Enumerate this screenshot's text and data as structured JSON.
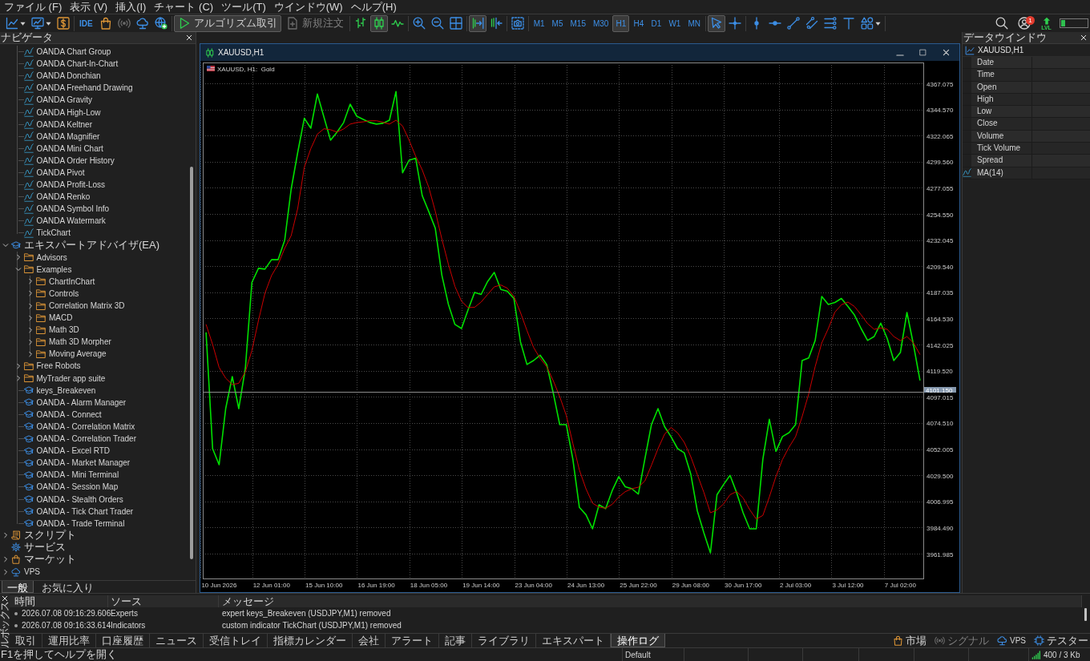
{
  "menu": [
    "ファイル (F)",
    "表示 (V)",
    "挿入(I)",
    "チャート (C)",
    "ツール(T)",
    "ウインドウ(W)",
    "ヘルプ(H)"
  ],
  "toolbar": {
    "groups": [
      {
        "items": [
          {
            "kind": "new_chart"
          },
          {
            "kind": "profiles"
          },
          {
            "kind": "dollar"
          }
        ]
      },
      {
        "items": [
          {
            "kind": "ide",
            "label": "IDE",
            "disabled": false
          },
          {
            "kind": "market",
            "disabled": false
          },
          {
            "kind": "signals",
            "disabled": true
          },
          {
            "kind": "vps",
            "disabled": false
          },
          {
            "kind": "webtrader",
            "disabled": false
          }
        ]
      },
      {
        "items": [
          {
            "kind": "algo",
            "label": "アルゴリズム取引",
            "selected": true,
            "disabled": false
          },
          {
            "kind": "new_order",
            "label": "新規注文",
            "selected": false,
            "disabled": true
          }
        ]
      },
      {
        "items": [
          {
            "kind": "bars",
            "selected": false
          },
          {
            "kind": "candles",
            "selected": true
          },
          {
            "kind": "line",
            "selected": false
          }
        ]
      },
      {
        "items": [
          {
            "kind": "zoom_in"
          },
          {
            "kind": "zoom_out"
          },
          {
            "kind": "tile"
          }
        ]
      },
      {
        "items": [
          {
            "kind": "autoscroll",
            "selected": true
          },
          {
            "kind": "shift",
            "selected": false
          }
        ]
      },
      {
        "items": [
          {
            "kind": "screenshot"
          }
        ]
      },
      {
        "items": [
          {
            "kind": "tf",
            "label": "M1",
            "selected": false
          },
          {
            "kind": "tf",
            "label": "M5",
            "selected": false
          },
          {
            "kind": "tf",
            "label": "M15",
            "selected": false
          },
          {
            "kind": "tf",
            "label": "M30",
            "selected": false
          },
          {
            "kind": "tf",
            "label": "H1",
            "selected": true
          },
          {
            "kind": "tf",
            "label": "H4",
            "selected": false
          },
          {
            "kind": "tf",
            "label": "D1",
            "selected": false
          },
          {
            "kind": "tf",
            "label": "W1",
            "selected": false
          },
          {
            "kind": "tf",
            "label": "MN",
            "selected": false
          }
        ]
      },
      {
        "items": [
          {
            "kind": "cursor",
            "selected": true
          },
          {
            "kind": "crosshair",
            "selected": false
          }
        ]
      },
      {
        "items": [
          {
            "kind": "vline"
          },
          {
            "kind": "hline"
          },
          {
            "kind": "trendline"
          },
          {
            "kind": "channel"
          },
          {
            "kind": "fibo"
          },
          {
            "kind": "text"
          },
          {
            "kind": "shapes"
          }
        ]
      }
    ],
    "right": [
      {
        "kind": "search"
      },
      {
        "kind": "account",
        "badge": "1"
      },
      {
        "kind": "level",
        "label": "LVL"
      }
    ],
    "meter": {
      "level": 0.15
    }
  },
  "navigator": {
    "title": "ナビゲータ",
    "tree": [
      {
        "children": [
          {
            "kind": "indicator",
            "label": "OANDA Chart Group"
          },
          {
            "kind": "indicator",
            "label": "OANDA Chart-In-Chart"
          },
          {
            "kind": "indicator",
            "label": "OANDA Donchian"
          },
          {
            "kind": "indicator",
            "label": "OANDA Freehand Drawing"
          },
          {
            "kind": "indicator",
            "label": "OANDA Gravity"
          },
          {
            "kind": "indicator",
            "label": "OANDA High-Low"
          },
          {
            "kind": "indicator",
            "label": "OANDA Keltner"
          },
          {
            "kind": "indicator",
            "label": "OANDA Magnifier"
          },
          {
            "kind": "indicator",
            "label": "OANDA Mini Chart"
          },
          {
            "kind": "indicator",
            "label": "OANDA Order History"
          },
          {
            "kind": "indicator",
            "label": "OANDA Pivot"
          },
          {
            "kind": "indicator",
            "label": "OANDA Profit-Loss"
          },
          {
            "kind": "indicator",
            "label": "OANDA Renko"
          },
          {
            "kind": "indicator",
            "label": "OANDA Symbol Info"
          },
          {
            "kind": "indicator",
            "label": "OANDA Watermark"
          },
          {
            "kind": "indicator",
            "label": "TickChart"
          }
        ]
      },
      {
        "kind": "expert",
        "label": "エキスパートアドバイザ(EA)",
        "expanded": true,
        "children": [
          {
            "kind": "folder",
            "label": "Advisors",
            "expanded": false
          },
          {
            "kind": "folder",
            "label": "Examples",
            "expanded": true,
            "children": [
              {
                "kind": "folder",
                "label": "ChartInChart",
                "expanded": false
              },
              {
                "kind": "folder",
                "label": "Controls",
                "expanded": false
              },
              {
                "kind": "folder",
                "label": "Correlation Matrix 3D",
                "expanded": false
              },
              {
                "kind": "folder",
                "label": "MACD",
                "expanded": false
              },
              {
                "kind": "folder",
                "label": "Math 3D",
                "expanded": false
              },
              {
                "kind": "folder",
                "label": "Math 3D Morpher",
                "expanded": false
              },
              {
                "kind": "folder",
                "label": "Moving Average",
                "expanded": false
              }
            ]
          },
          {
            "kind": "folder",
            "label": "Free Robots",
            "expanded": false
          },
          {
            "kind": "folder",
            "label": "MyTrader app suite",
            "expanded": false
          },
          {
            "kind": "expert",
            "label": "keys_Breakeven"
          },
          {
            "kind": "expert",
            "label": "OANDA - Alarm Manager"
          },
          {
            "kind": "expert",
            "label": "OANDA - Connect"
          },
          {
            "kind": "expert",
            "label": "OANDA - Correlation Matrix"
          },
          {
            "kind": "expert",
            "label": "OANDA - Correlation Trader"
          },
          {
            "kind": "expert",
            "label": "OANDA - Excel RTD"
          },
          {
            "kind": "expert",
            "label": "OANDA - Market Manager"
          },
          {
            "kind": "expert",
            "label": "OANDA - Mini Terminal"
          },
          {
            "kind": "expert",
            "label": "OANDA - Session Map"
          },
          {
            "kind": "expert",
            "label": "OANDA - Stealth Orders"
          },
          {
            "kind": "expert",
            "label": "OANDA - Tick Chart Trader"
          },
          {
            "kind": "expert",
            "label": "OANDA - Trade Terminal"
          }
        ]
      },
      {
        "kind": "script",
        "label": "スクリプト",
        "expanded": false
      },
      {
        "kind": "service",
        "label": "サービス"
      },
      {
        "kind": "market",
        "label": "マーケット",
        "expanded": false
      },
      {
        "kind": "vps",
        "label": "VPS",
        "expanded": false
      }
    ],
    "tabs": [
      {
        "label": "一般",
        "selected": true
      },
      {
        "label": "お気に入り",
        "selected": false
      }
    ]
  },
  "chart_window": {
    "title": "XAUUSD,H1",
    "info": "XAUUSD, H1:  Gold",
    "chart_data": {
      "type": "line",
      "grid": true,
      "categories": [
        null,
        null,
        "10 Jun 2026",
        null,
        null,
        null,
        null,
        null,
        null,
        null,
        "12 Jun 01:00",
        null,
        null,
        null,
        null,
        null,
        null,
        null,
        "15 Jun 10:00",
        null,
        null,
        null,
        null,
        null,
        null,
        null,
        "16 Jun 19:00",
        null,
        null,
        null,
        null,
        null,
        null,
        null,
        "18 Jun 05:00",
        null,
        null,
        null,
        null,
        null,
        null,
        null,
        "19 Jun 14:00",
        null,
        null,
        null,
        null,
        null,
        null,
        null,
        "23 Jun 04:00",
        null,
        null,
        null,
        null,
        null,
        null,
        null,
        "24 Jun 13:00",
        null,
        null,
        null,
        null,
        null,
        null,
        null,
        "25 Jun 22:00",
        null,
        null,
        null,
        null,
        null,
        null,
        null,
        "29 Jun 08:00",
        null,
        null,
        null,
        null,
        null,
        null,
        null,
        "30 Jun 17:00",
        null,
        null,
        null,
        null,
        null,
        null,
        null,
        "2 Jul 03:00",
        null,
        null,
        null,
        null,
        null,
        null,
        null,
        "3 Jul 12:00",
        null,
        null,
        null,
        null,
        null,
        null,
        null,
        "7 Jul 02:00",
        null,
        null,
        null
      ],
      "series": [
        {
          "color": "#00e000",
          "values": [
            4152.5,
            4052.4,
            4038.6,
            4086.9,
            4114.5,
            4086.9,
            4121.4,
            4195.6,
            4207.7,
            4207.0,
            4215.2,
            4215.2,
            4231.8,
            4276.0,
            4307.7,
            4337.0,
            4328.4,
            4357.8,
            4337.9,
            4318.1,
            4325.0,
            4333.2,
            4349.1,
            4338.8,
            4336.0,
            4333.3,
            4331.9,
            4332.6,
            4335.3,
            4360.0,
            4290.0,
            4300.8,
            4302.6,
            4270.4,
            4256.6,
            4242.2,
            4201.9,
            4176.6,
            4159.4,
            4155.9,
            4172.0,
            4187.0,
            4185.2,
            4196.5,
            4204.2,
            4189.6,
            4187.9,
            4181.8,
            4144.4,
            4124.9,
            4128.3,
            4132.9,
            4124.9,
            4100.7,
            4073.1,
            4073.1,
            4043.2,
            4001.8,
            3995.5,
            3983.4,
            4004.1,
            4000.7,
            4016.2,
            4028.3,
            4019.6,
            4017.9,
            4013.3,
            4043.8,
            4073.1,
            4086.9,
            4071.4,
            4062.7,
            4052.4,
            4048.9,
            4030.5,
            3998.9,
            3980.0,
            3962.7,
            4012.7,
            4021.4,
            4029.4,
            4014.5,
            3997.2,
            3983.4,
            3983.4,
            4043.2,
            4077.7,
            4050.1,
            4062.8,
            4066.2,
            4073.1,
            4128.3,
            4130.6,
            4145.6,
            4183.5,
            4176.6,
            4178.3,
            4181.8,
            4174.9,
            4167.4,
            4155.9,
            4145.6,
            4149.0,
            4160.5,
            4147.3,
            4128.3,
            4135.2,
            4169.7,
            4142.1,
            4111.1
          ]
        },
        {
          "color": "#cc0000",
          "values": [
            4159.4,
            4142.1,
            4122.3,
            4113.1,
            4107.6,
            4108.7,
            4118.5,
            4137.0,
            4162.8,
            4186.3,
            4201.5,
            4211.1,
            4224.9,
            4235.9,
            4259.4,
            4294.8,
            4310.8,
            4323.3,
            4327.9,
            4327.1,
            4325.0,
            4327.7,
            4331.9,
            4333.3,
            4333.9,
            4334.8,
            4334.8,
            4333.6,
            4331.9,
            4335.3,
            4330.3,
            4318.1,
            4304.3,
            4292.5,
            4277.4,
            4256.9,
            4233.0,
            4211.2,
            4192.2,
            4179.4,
            4173.9,
            4174.2,
            4178.7,
            4185.3,
            4191.8,
            4193.4,
            4190.6,
            4183.6,
            4169.7,
            4154.2,
            4139.7,
            4130.1,
            4123.1,
            4111.1,
            4097.2,
            4080.9,
            4056.9,
            4034.0,
            4017.9,
            4005.5,
            4002.0,
            4001.1,
            4004.4,
            4010.8,
            4015.3,
            4017.9,
            4019.3,
            4024.7,
            4038.1,
            4052.4,
            4064.9,
            4070.7,
            4065.9,
            4057.9,
            4045.5,
            4030.2,
            4014.8,
            3997.2,
            3999.6,
            4004.8,
            4012.8,
            4015.5,
            4010.0,
            3999.9,
            3991.7,
            3994.9,
            4010.8,
            4028.3,
            4043.1,
            4053.7,
            4062.7,
            4080.0,
            4099.5,
            4123.1,
            4143.5,
            4155.9,
            4170.0,
            4176.3,
            4178.7,
            4174.8,
            4167.7,
            4160.1,
            4155.2,
            4156.4,
            4155.2,
            4149.0,
            4145.5,
            4149.0,
            4143.5,
            4133.5
          ]
        }
      ],
      "ylim": [
        3940.6,
        4385.0
      ],
      "yticks": [
        {
          "value": 4367.075,
          "label": "4367.075"
        },
        {
          "value": 4344.57,
          "label": "4344.570"
        },
        {
          "value": 4322.065,
          "label": "4322.065"
        },
        {
          "value": 4299.56,
          "label": "4299.560"
        },
        {
          "value": 4277.055,
          "label": "4277.055"
        },
        {
          "value": 4254.55,
          "label": "4254.550"
        },
        {
          "value": 4232.045,
          "label": "4232.045"
        },
        {
          "value": 4209.54,
          "label": "4209.540"
        },
        {
          "value": 4187.035,
          "label": "4187.035"
        },
        {
          "value": 4164.53,
          "label": "4164.530"
        },
        {
          "value": 4142.025,
          "label": "4142.025"
        },
        {
          "value": 4119.52,
          "label": "4119.520"
        },
        {
          "value": 4097.015,
          "label": "4097.015"
        },
        {
          "value": 4074.51,
          "label": "4074.510"
        },
        {
          "value": 4052.005,
          "label": "4052.005"
        },
        {
          "value": 4029.5,
          "label": "4029.500"
        },
        {
          "value": 4006.995,
          "label": "4006.995"
        },
        {
          "value": 3984.49,
          "label": "3984.490"
        },
        {
          "value": 3961.985,
          "label": "3961.985"
        }
      ],
      "ref_lines": [
        {
          "axis": "y",
          "value": 4101.15,
          "label": "4101.150"
        }
      ]
    }
  },
  "data_window": {
    "title": "データウインドウ",
    "rows": [
      {
        "kind": "symbol",
        "label": "XAUUSD,H1"
      },
      {
        "kind": "field",
        "label": "Date"
      },
      {
        "kind": "field",
        "label": "Time"
      },
      {
        "kind": "field",
        "label": "Open"
      },
      {
        "kind": "field",
        "label": "High"
      },
      {
        "kind": "field",
        "label": "Low"
      },
      {
        "kind": "field",
        "label": "Close"
      },
      {
        "kind": "field",
        "label": "Volume"
      },
      {
        "kind": "field",
        "label": "Tick Volume"
      },
      {
        "kind": "field",
        "label": "Spread"
      },
      {
        "kind": "indicator",
        "label": "MA(14)"
      }
    ]
  },
  "toolbox": {
    "title": "ルボックス",
    "columns": [
      "時間",
      "ソース",
      "メッセージ"
    ],
    "rows": [
      {
        "time": "2026.07.08 09:16:29.606",
        "source": "Experts",
        "message": "expert keys_Breakeven (USDJPY,M1) removed"
      },
      {
        "time": "2026.07.08 09:16:33.614",
        "source": "Indicators",
        "message": "custom indicator TickChart (USDJPY,M1) removed"
      }
    ],
    "tabs": [
      {
        "label": "取引",
        "selected": false
      },
      {
        "label": "運用比率",
        "selected": false
      },
      {
        "label": "口座履歴",
        "selected": false
      },
      {
        "label": "ニュース",
        "selected": false
      },
      {
        "label": "受信トレイ",
        "selected": false
      },
      {
        "label": "指標カレンダー",
        "selected": false
      },
      {
        "label": "会社",
        "selected": false
      },
      {
        "label": "アラート",
        "selected": false
      },
      {
        "label": "記事",
        "selected": false
      },
      {
        "label": "ライブラリ",
        "selected": false
      },
      {
        "label": "エキスパート",
        "selected": false
      },
      {
        "label": "操作ログ",
        "selected": true
      }
    ],
    "services": [
      {
        "kind": "market",
        "label": "市場",
        "disabled": false
      },
      {
        "kind": "signals",
        "label": "シグナル",
        "disabled": true
      },
      {
        "kind": "vps",
        "label": "VPS",
        "disabled": false
      },
      {
        "kind": "tester",
        "label": "テスター",
        "disabled": false
      }
    ]
  },
  "status_bar": {
    "hint": "F1を押してヘルプを開く",
    "profile": "Default",
    "connection": "400 / 3 Kb"
  }
}
